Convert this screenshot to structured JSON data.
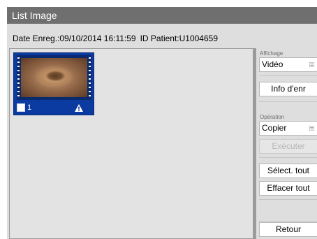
{
  "window": {
    "title": "List Image"
  },
  "info": {
    "date": "Date Enreg.:09/10/2014 16:11:59",
    "patient": "ID Patient:U1004659"
  },
  "thumbnails": [
    {
      "number": "1",
      "checked": false
    }
  ],
  "side_panel": {
    "display_section": {
      "label": "Affichage",
      "dropdown_value": "Vidéo",
      "info_button": "Info d'enr"
    },
    "operation_section": {
      "label": "Opération",
      "dropdown_value": "Copier",
      "execute_button": "Exécuter"
    },
    "select_all_button": "Sélect. tout",
    "clear_all_button": "Effacer tout",
    "back_button": "Retour"
  },
  "icons": {
    "dropdown": "list-icon",
    "warning": "warning-triangle-icon"
  },
  "colors": {
    "titlebar": "#6f6f6f",
    "selection": "#0b3aa0",
    "panel": "#dedede"
  }
}
